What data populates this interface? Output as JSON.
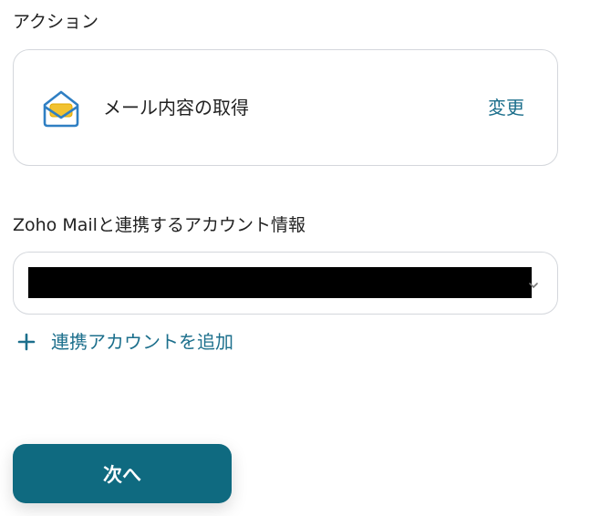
{
  "action_section": {
    "title": "アクション",
    "action_name": "メール内容の取得",
    "change_label": "変更",
    "app_icon": "zoho-mail-envelope-icon"
  },
  "account_section": {
    "title": "Zoho Mailと連携するアカウント情報",
    "selected_value": "",
    "add_account_label": "連携アカウントを追加"
  },
  "footer": {
    "next_label": "次へ"
  },
  "colors": {
    "accent": "#1c6f8c",
    "button_bg": "#0f6a80",
    "border": "#d4d7dc"
  }
}
